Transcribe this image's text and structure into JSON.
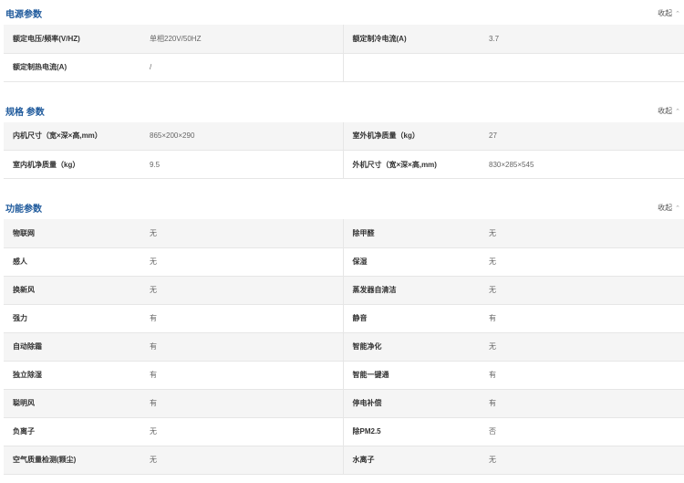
{
  "collapse_label": "收起",
  "sections": [
    {
      "title": "电源参数",
      "rows": [
        [
          "额定电压/频率(V/HZ)",
          "单相220V/50HZ",
          "额定制冷电流(A)",
          "3.7"
        ],
        [
          "额定制热电流(A)",
          "/",
          "",
          ""
        ]
      ]
    },
    {
      "title": "规格 参数",
      "rows": [
        [
          "内机尺寸（宽×深×高,mm）",
          "865×200×290",
          "室外机净质量（kg）",
          "27"
        ],
        [
          "室内机净质量（kg）",
          "9.5",
          "外机尺寸（宽×深×高,mm)",
          "830×285×545"
        ]
      ]
    },
    {
      "title": "功能参数",
      "rows": [
        [
          "物联网",
          "无",
          "除甲醛",
          "无"
        ],
        [
          "感人",
          "无",
          "保湿",
          "无"
        ],
        [
          "换新风",
          "无",
          "蒸发器自清洁",
          "无"
        ],
        [
          "强力",
          "有",
          "静音",
          "有"
        ],
        [
          "自动除霜",
          "有",
          "智能净化",
          "无"
        ],
        [
          "独立除湿",
          "有",
          "智能一键通",
          "有"
        ],
        [
          "聪明风",
          "有",
          "停电补偿",
          "有"
        ],
        [
          "负离子",
          "无",
          "除PM2.5",
          "否"
        ],
        [
          "空气质量检测(颗尘)",
          "无",
          "水离子",
          "无"
        ]
      ]
    }
  ]
}
